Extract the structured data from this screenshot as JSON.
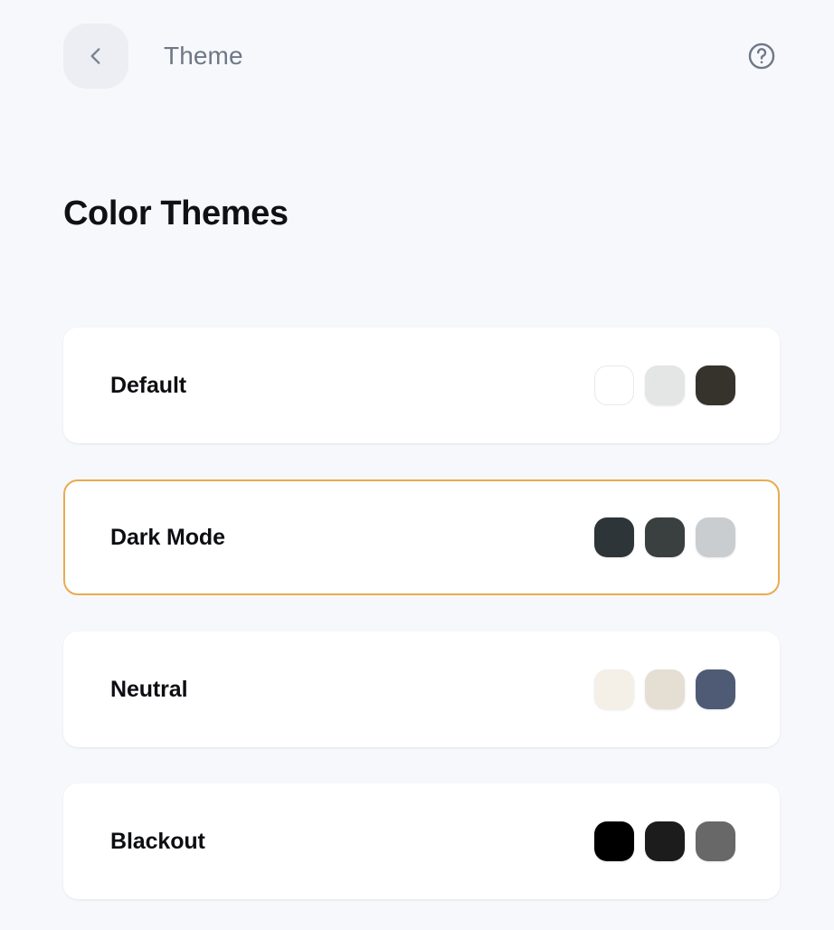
{
  "topbar": {
    "back_icon": "chevron-left-icon",
    "title": "Theme",
    "help_icon": "help-circle-icon"
  },
  "page": {
    "heading": "Color Themes",
    "background_color": "#F6F8FC"
  },
  "selection": {
    "selected_theme": "Dark Mode",
    "highlight_color": "#E9AB4F"
  },
  "themes": [
    {
      "name": "Default",
      "selected": false,
      "swatches": [
        "#FFFFFF",
        "#E4E5E5",
        "#36332D"
      ]
    },
    {
      "name": "Dark Mode",
      "selected": true,
      "swatches": [
        "#2E3539",
        "#3A3F40",
        "#CACDCF"
      ]
    },
    {
      "name": "Neutral",
      "selected": false,
      "swatches": [
        "#F4EFE7",
        "#E5DED3",
        "#4F5B75"
      ]
    },
    {
      "name": "Blackout",
      "selected": false,
      "swatches": [
        "#000000",
        "#1C1C1C",
        "#686868"
      ]
    }
  ]
}
